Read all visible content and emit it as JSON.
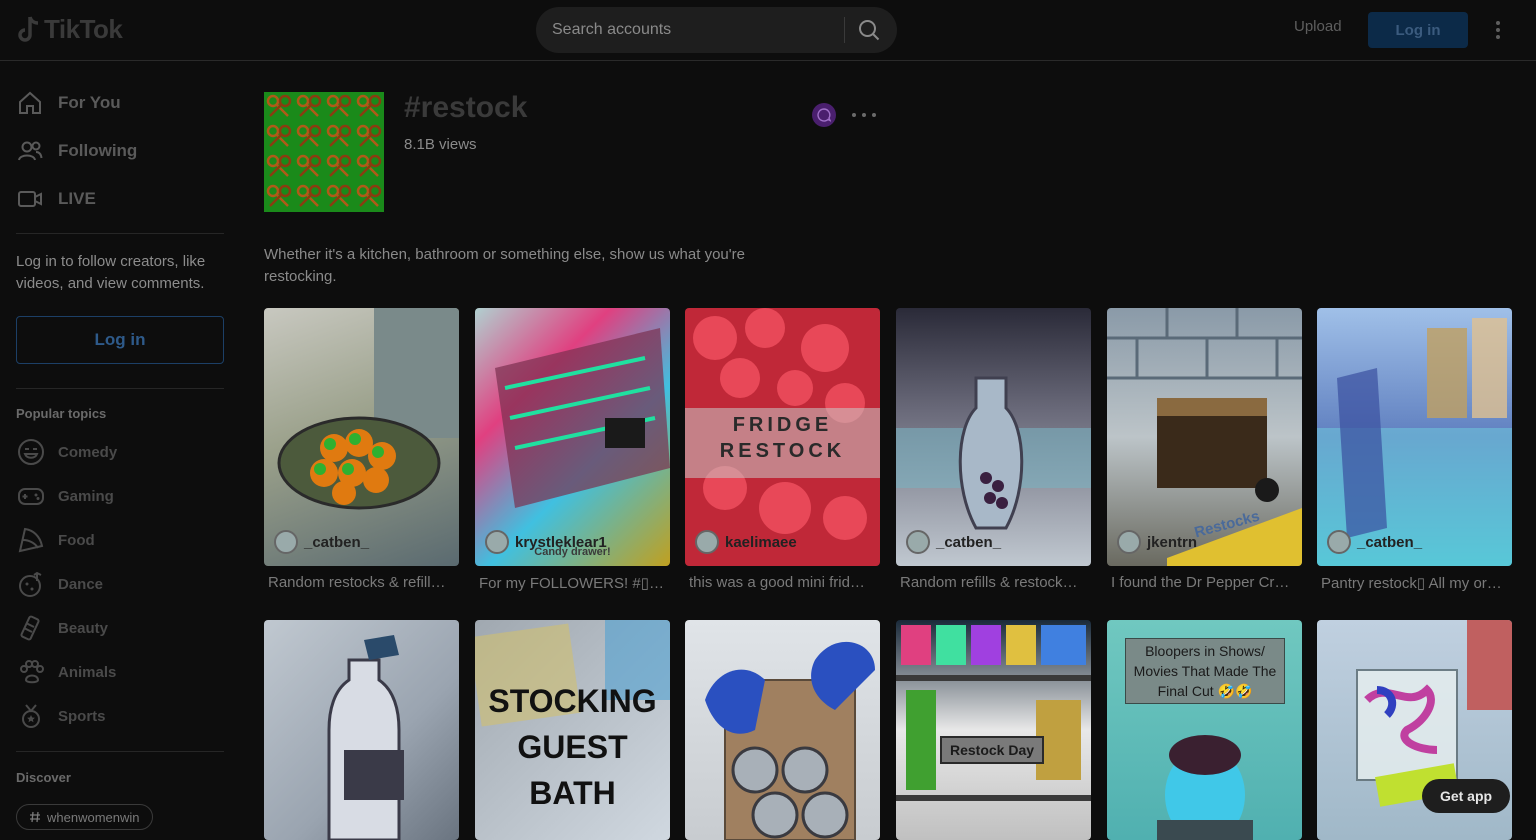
{
  "header": {
    "brand": "TikTok",
    "search_placeholder": "Search accounts",
    "upload_label": "Upload",
    "login_label": "Log in"
  },
  "sidebar": {
    "nav": [
      {
        "label": "For You",
        "icon": "home-icon"
      },
      {
        "label": "Following",
        "icon": "users-icon"
      },
      {
        "label": "LIVE",
        "icon": "live-icon"
      }
    ],
    "login_hint": "Log in to follow creators, like videos, and view comments.",
    "login_label": "Log in",
    "popular_title": "Popular topics",
    "topics": [
      {
        "label": "Comedy",
        "icon": "comedy-icon"
      },
      {
        "label": "Gaming",
        "icon": "gaming-icon"
      },
      {
        "label": "Food",
        "icon": "food-icon"
      },
      {
        "label": "Dance",
        "icon": "dance-icon"
      },
      {
        "label": "Beauty",
        "icon": "beauty-icon"
      },
      {
        "label": "Animals",
        "icon": "animals-icon"
      },
      {
        "label": "Sports",
        "icon": "sports-icon"
      }
    ],
    "discover_title": "Discover",
    "discover_chip": "whenwomenwin"
  },
  "tag": {
    "title": "#restock",
    "views": "8.1B views",
    "description": "Whether it's a kitchen, bathroom or something else, show us what you're restocking."
  },
  "videos_row1": [
    {
      "author": "_catben_",
      "caption": "Random restocks & refill…"
    },
    {
      "author": "krystleklear1",
      "caption": "For my FOLLOWERS! #▯ …",
      "overlay": "Candy drawer!"
    },
    {
      "author": "kaelimaee",
      "caption": "this was a good mini frid…",
      "overlay": "FRIDGE RESTOCK"
    },
    {
      "author": "_catben_",
      "caption": "Random refills & restock…"
    },
    {
      "author": "jkentrn",
      "caption": "I found the Dr Pepper Cr…",
      "overlay": "Restocks"
    },
    {
      "author": "_catben_",
      "caption": "Pantry restock▯ All my or…"
    }
  ],
  "videos_row2": [
    {
      "overlay": ""
    },
    {
      "overlay": "STOCKING GUEST BATH"
    },
    {
      "overlay": ""
    },
    {
      "overlay": "Restock Day"
    },
    {
      "overlay": "Bloopers in Shows/ Movies That Made The Final Cut 🤣🤣"
    },
    {
      "overlay": ""
    }
  ],
  "get_app_label": "Get app",
  "colors": {
    "background": "#0d0d0d",
    "accent_blue": "#0c2a48",
    "tag_thumb": "#1a8a1a"
  }
}
